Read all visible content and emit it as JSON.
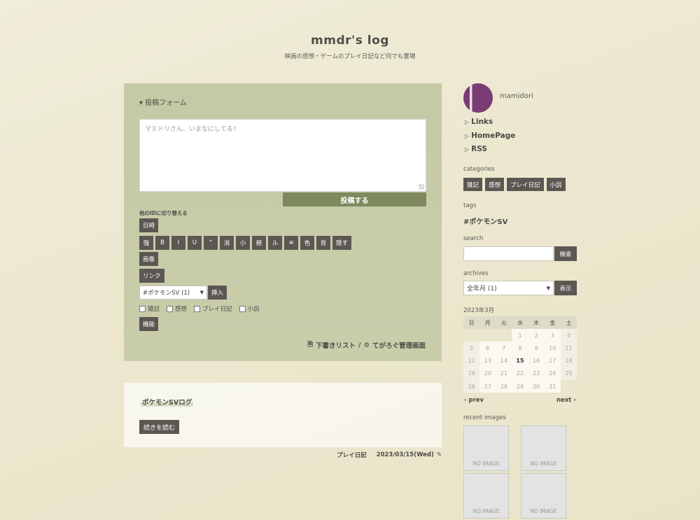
{
  "blog": {
    "title": "mmdr's log",
    "description": "映画の感想・ゲームのプレイ日記など何でも置場"
  },
  "post_form": {
    "toggle_label": "▾ 投稿フォーム",
    "textarea_placeholder": "マミドリさん、いまなにしてる?",
    "submit_label": "投稿する",
    "switch_id_label": "他のIDに切り替える",
    "toolbar_row1": [
      "日時"
    ],
    "toolbar_row2": [
      "強",
      "B",
      "I",
      "U",
      "\"",
      "消",
      "小",
      "極",
      "ル",
      "≡",
      "色",
      "背",
      "隠す"
    ],
    "toolbar_row3": [
      "画像"
    ],
    "toolbar_row4": [
      "リンク"
    ],
    "tag_select_value": "#ポケモンSV (1)",
    "insert_label": "挿入",
    "categories": [
      "雑記",
      "感想",
      "プレイ日記",
      "小説"
    ],
    "function_label": "機能",
    "drafts_link": "下書きリスト",
    "separator": "/",
    "admin_link": "てがろぐ管理画面"
  },
  "article": {
    "title": "ポケモンSVログ",
    "readmore_label": "続きを読む",
    "category": "プレイ日記",
    "date": "2023/03/15(Wed)"
  },
  "sidebar": {
    "username": "mamidori",
    "links": [
      "Links",
      "HomePage",
      "RSS"
    ],
    "categories_label": "categories",
    "categories": [
      "雑記",
      "感想",
      "プレイ日記",
      "小説"
    ],
    "tags_label": "tags",
    "tags": [
      "#ポケモンSV"
    ],
    "search_label": "search",
    "search_button": "検索",
    "archives_label": "archives",
    "archives_select_value": "全年月 (1)",
    "archives_button": "表示",
    "calendar": {
      "title": "2023年3月",
      "weekdays": [
        "日",
        "月",
        "火",
        "水",
        "木",
        "金",
        "土"
      ],
      "weeks": [
        [
          "",
          "",
          "",
          "1",
          "2",
          "3",
          "4"
        ],
        [
          "5",
          "6",
          "7",
          "8",
          "9",
          "10",
          "11"
        ],
        [
          "12",
          "13",
          "14",
          "15",
          "16",
          "17",
          "18"
        ],
        [
          "19",
          "20",
          "21",
          "22",
          "23",
          "24",
          "25"
        ],
        [
          "26",
          "27",
          "28",
          "29",
          "30",
          "31",
          ""
        ]
      ],
      "today": "15",
      "prev_label": "prev",
      "next_label": "next"
    },
    "recent_images_label": "recent images",
    "recent_images": [
      "NO IMAGE",
      "NO IMAGE",
      "NO IMAGE",
      "NO IMAGE"
    ]
  }
}
